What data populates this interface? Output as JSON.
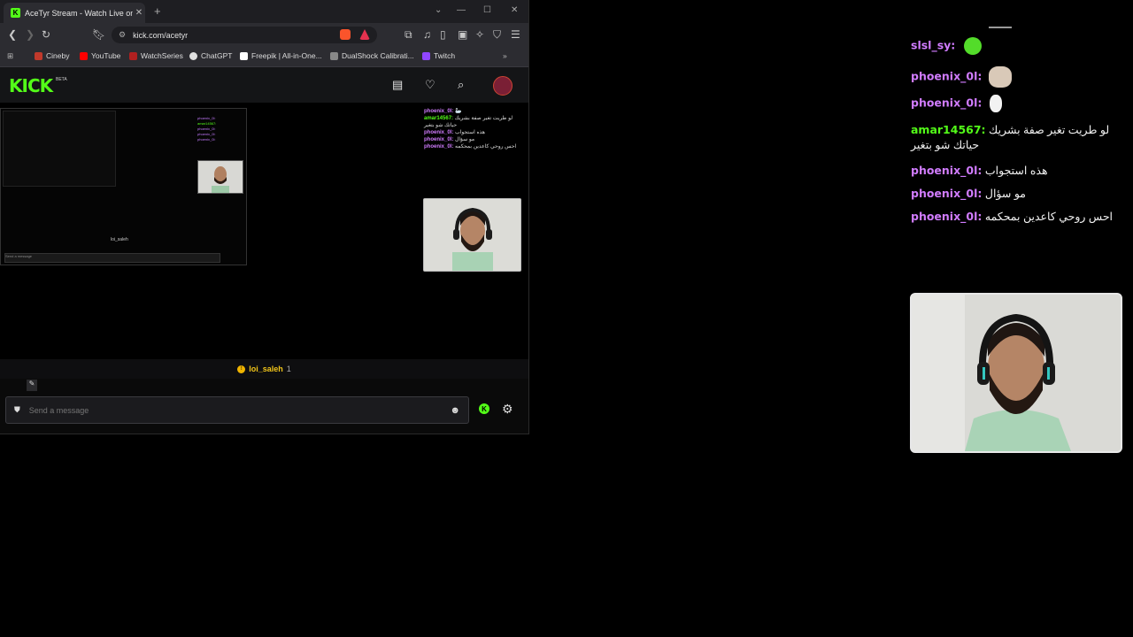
{
  "browser": {
    "tab_title": "AceTyr Stream - Watch Live on Kick",
    "tab_favicon": "K",
    "url": "kick.com/acetyr",
    "bookmarks": [
      {
        "label": "Cineby",
        "color": "#c0392b"
      },
      {
        "label": "YouTube",
        "color": "#ff0000"
      },
      {
        "label": "WatchSeries",
        "color": "#b02020"
      },
      {
        "label": "ChatGPT",
        "color": "#e0e0e0"
      },
      {
        "label": "Freepik | All-in-One...",
        "color": "#ffffff"
      },
      {
        "label": "DualShock Calibrati...",
        "color": "#888888"
      },
      {
        "label": "Twitch",
        "color": "#9146ff"
      }
    ]
  },
  "kick": {
    "logo": "KICK",
    "beta": "BETA",
    "brand_color": "#53fc18",
    "host_name": "loi_saleh",
    "host_count": "1",
    "message_placeholder": "Send a message",
    "nested_host": "loi_saleh",
    "nested_placeholder": "Send a message"
  },
  "inner_chat": [
    {
      "user": "phoenix_0l:",
      "color": "#d17cff",
      "msg": "🦢"
    },
    {
      "user": "amar14567:",
      "color": "#53fc18",
      "msg": "لو طريت تغير صفة بشريك حياتك شو بتغير"
    },
    {
      "user": "phoenix_0l:",
      "color": "#d17cff",
      "msg": "هذه استجواب"
    },
    {
      "user": "phoenix_0l:",
      "color": "#d17cff",
      "msg": "مو سؤال"
    },
    {
      "user": "phoenix_0l:",
      "color": "#d17cff",
      "msg": "احس روحي كاعدين بمحكمه"
    }
  ],
  "overlay_chat": [
    {
      "user": "slsl_sy:",
      "color": "#d17cff",
      "msg": "",
      "emote": "green-blob-emote"
    },
    {
      "user": "phoenix_0l:",
      "color": "#d17cff",
      "msg": "",
      "emote": "cat-emote"
    },
    {
      "user": "phoenix_0l:",
      "color": "#d17cff",
      "msg": "",
      "emote": "goose-emote"
    },
    {
      "user": "amar14567:",
      "color": "#53fc18",
      "msg": "لو طريت تغير صفة بشريك حياتك شو بتغير"
    },
    {
      "user": "phoenix_0l:",
      "color": "#d17cff",
      "msg": "هذه استجواب"
    },
    {
      "user": "phoenix_0l:",
      "color": "#d17cff",
      "msg": "مو سؤال"
    },
    {
      "user": "phoenix_0l:",
      "color": "#d17cff",
      "msg": "احس روحي كاعدين بمحكمه"
    }
  ]
}
